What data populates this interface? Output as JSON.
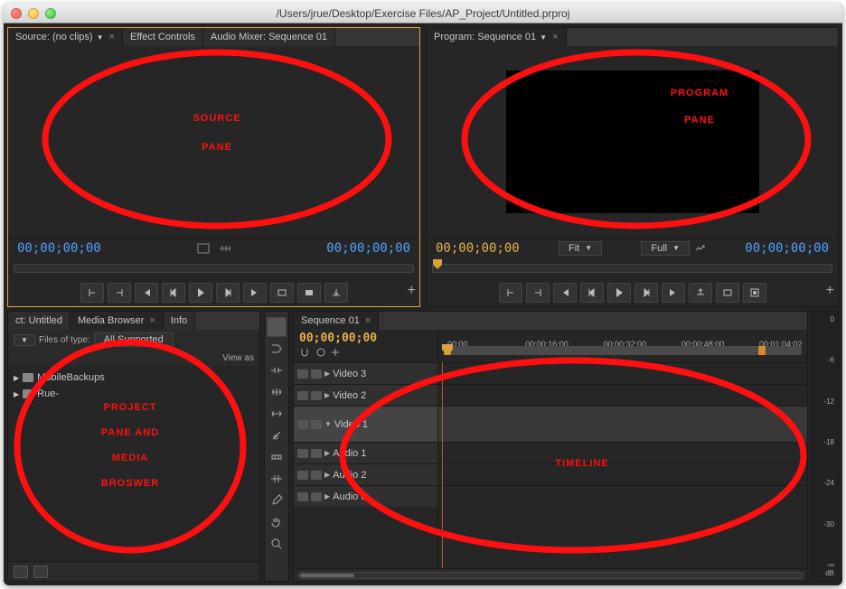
{
  "window": {
    "title": "/Users/jrue/Desktop/Exercise Files/AP_Project/Untitled.prproj"
  },
  "source": {
    "tabs": [
      {
        "label": "Source: (no clips)",
        "active": true,
        "closable": true
      },
      {
        "label": "Effect Controls",
        "active": false
      },
      {
        "label": "Audio Mixer: Sequence 01",
        "active": false
      }
    ],
    "tc_left": "00;00;00;00",
    "tc_right": "00;00;00;00"
  },
  "program": {
    "tabs": [
      {
        "label": "Program: Sequence 01",
        "active": true,
        "closable": true
      }
    ],
    "tc_left": "00;00;00;00",
    "tc_right": "00;00;00;00",
    "fit_label": "Fit",
    "quality_label": "Full"
  },
  "project": {
    "tabs": [
      {
        "label": "ct: Untitled",
        "active": false
      },
      {
        "label": "Media Browser",
        "active": true,
        "closable": true
      },
      {
        "label": "Info",
        "active": false
      }
    ],
    "filetype_label": "Files of type:",
    "filetype_value": "All Supported",
    "viewas_label": "View as",
    "items": [
      {
        "label": "MobileBackups"
      },
      {
        "label": "Rue-"
      }
    ]
  },
  "timeline": {
    "tabs": [
      {
        "label": "Sequence 01",
        "active": true,
        "closable": true
      }
    ],
    "cti": "00;00;00;00",
    "ruler": [
      "00;00",
      "00;00;16;00",
      "00;00;32;00",
      "00;00;48;00",
      "00;01;04;02"
    ],
    "tracks": {
      "video": [
        "Video 3",
        "Video 2",
        "Video 1"
      ],
      "audio": [
        "Audio 1",
        "Audio 2",
        "Audio 3"
      ]
    }
  },
  "meter": {
    "ticks": [
      "0",
      "-6",
      "-12",
      "-18",
      "-24",
      "-30",
      "-∞"
    ],
    "db_label": "dB"
  },
  "annotations": {
    "source": [
      "SOURCE",
      "PANE"
    ],
    "program": [
      "PROGRAM",
      "PANE"
    ],
    "project": [
      "PROJECT",
      "PANE AND",
      "MEDIA",
      "BROSWER"
    ],
    "timeline": [
      "TIMELINE"
    ]
  },
  "tools": [
    "selection",
    "track-select",
    "ripple",
    "rolling",
    "rate-stretch",
    "razor",
    "slip",
    "slide",
    "pen",
    "hand",
    "zoom"
  ]
}
